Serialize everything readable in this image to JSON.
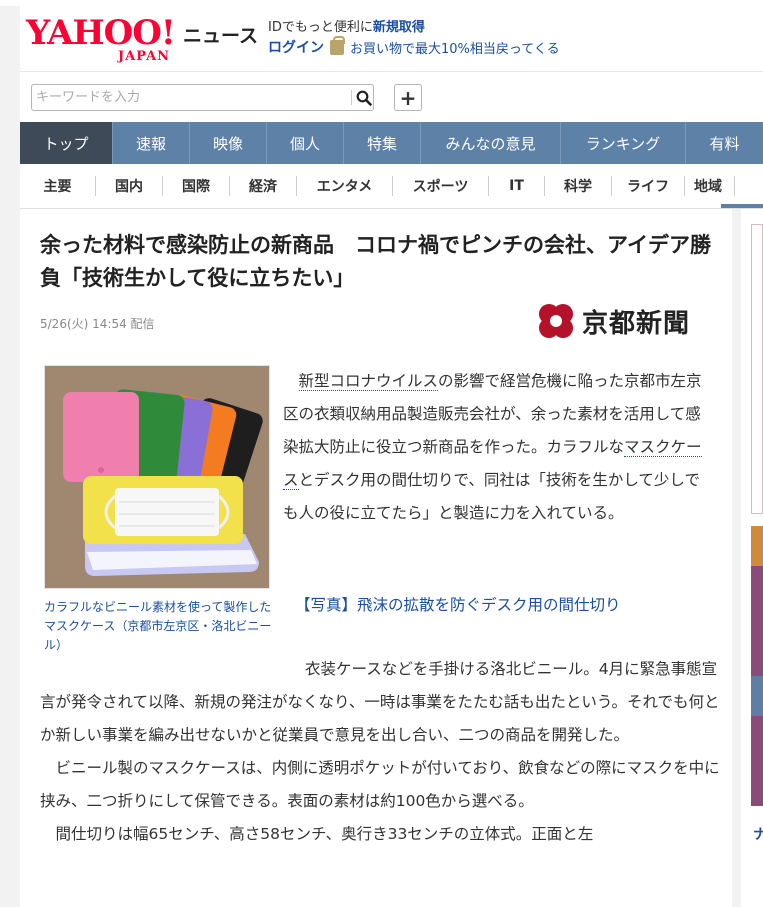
{
  "header": {
    "logo_text": "YAHOO!",
    "logo_sub": "JAPAN",
    "service": "ニュース",
    "id_line_prefix": "IDでもっと便利に",
    "id_line_link": "新規取得",
    "login": "ログイン",
    "shopping_promo": "お買い物で最大10%相当戻ってくる"
  },
  "search": {
    "placeholder": "キーワードを入力",
    "plus_label": "+"
  },
  "main_nav": [
    {
      "label": "トップ",
      "active": true
    },
    {
      "label": "速報"
    },
    {
      "label": "映像"
    },
    {
      "label": "個人"
    },
    {
      "label": "特集"
    },
    {
      "label": "みんなの意見"
    },
    {
      "label": "ランキング"
    },
    {
      "label": "有料"
    }
  ],
  "sub_nav": [
    {
      "label": "主要"
    },
    {
      "label": "国内"
    },
    {
      "label": "国際"
    },
    {
      "label": "経済"
    },
    {
      "label": "エンタメ"
    },
    {
      "label": "スポーツ"
    },
    {
      "label": "IT"
    },
    {
      "label": "科学"
    },
    {
      "label": "ライフ"
    },
    {
      "label": "地域",
      "active": true
    }
  ],
  "article": {
    "title": "余った材料で感染防止の新商品　コロナ禍でピンチの会社、アイデア勝負「技術生かして役に立ちたい」",
    "date": "5/26(火) 14:54 配信",
    "source": "京都新聞",
    "caption": "カラフルなビニール素材を使って製作したマスクケース（京都市左京区・洛北ビニール）",
    "para1_kw1": "新型コロナウイルス",
    "para1_a": "の影響で経営危機に陥った京都市左京区の衣類収納用品製造販売会社が、余った素材を活用して感染拡大防止に役立つ新商品を作った。カラフルな",
    "para1_kw2": "マスクケース",
    "para1_b": "とデスク用の間仕切りで、同社は「技術を生かして少しでも人の役に立てたら」と製造に力を入れている。",
    "photo_link": "【写真】飛沫の拡散を防ぐデスク用の間仕切り",
    "para2": "衣装ケースなどを手掛ける洛北ビニール。4月に緊急事態宣言が発令されて以降、新規の発注がなくなり、一時は事業をたたむ話も出たという。それでも何とか新しい事業を編み出せないかと従業員で意見を出し合い、二つの商品を開発した。",
    "para3": "ビニール製のマスクケースは、内側に透明ポケットが付いており、飲食などの際にマスクを中に挟み、二つ折りにして保管できる。表面の素材は約100色から選べる。",
    "para4": "間仕切りは幅65センチ、高さ58センチ、奥行き33センチの立体式。正面と左"
  },
  "right": {
    "label": "ナ"
  },
  "colors": {
    "nav_bg": "#5e81a8",
    "nav_active": "#3e4a57",
    "link": "#1a4fa3",
    "brand_red": "#ff0033",
    "source_red": "#b3122a"
  }
}
